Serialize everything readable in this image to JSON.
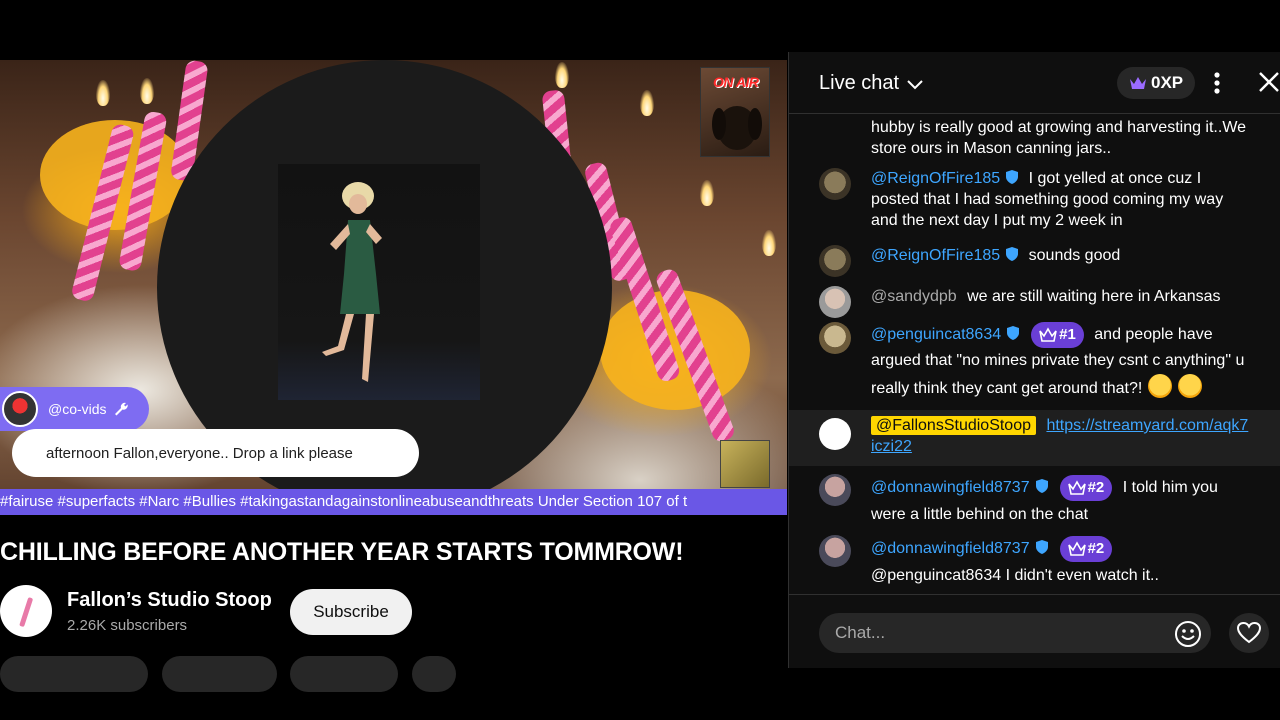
{
  "video": {
    "onair_label": "ON AIR",
    "commenter_handle": "@co-vids",
    "highlighted_comment": "afternoon Fallon,everyone.. Drop a link please",
    "ticker_text": "#fairuse #superfacts #Narc #Bullies #takingastandagainstonlineabuseandthreats Under Section 107 of t"
  },
  "title": "CHILLING BEFORE ANOTHER YEAR STARTS TOMMROW!",
  "channel": {
    "name": "Fallon’s Studio Stoop",
    "subscribers": "2.26K subscribers",
    "subscribe_label": "Subscribe"
  },
  "chat": {
    "title": "Live chat",
    "xp_label": "0XP",
    "messages": [
      {
        "author": "",
        "text": "hubby is really good at growing and harvesting it..We store ours in Mason canning jars.."
      },
      {
        "author": "@ReignOfFire185",
        "text": "I got yelled at once cuz I posted that I had something good coming my way and the next day I put my 2 week in"
      },
      {
        "author": "@ReignOfFire185",
        "text": "sounds good"
      },
      {
        "author": "@sandydpb",
        "text": "we are still waiting here in Arkansas"
      },
      {
        "author": "@penguincat8634",
        "badge": "#1",
        "text": "and people have argued that \"no mines private they csnt c anything\" u really think they cant get around that?!"
      },
      {
        "author": "@FallonsStudioStoop",
        "text": "https://streamyard.com/aqk7iczi22"
      },
      {
        "author": "@donnawingfield8737",
        "badge": "#2",
        "text": "I told him you were a little behind on the chat"
      },
      {
        "author": "@donnawingfield8737",
        "badge": "#2",
        "text": "@penguincat8634 I didn't even watch it.."
      }
    ],
    "input_placeholder": "Chat..."
  },
  "colors": {
    "accent_purple": "#7e6cf2",
    "link_blue": "#3ea6ff",
    "owner_yellow": "#ffd600"
  }
}
